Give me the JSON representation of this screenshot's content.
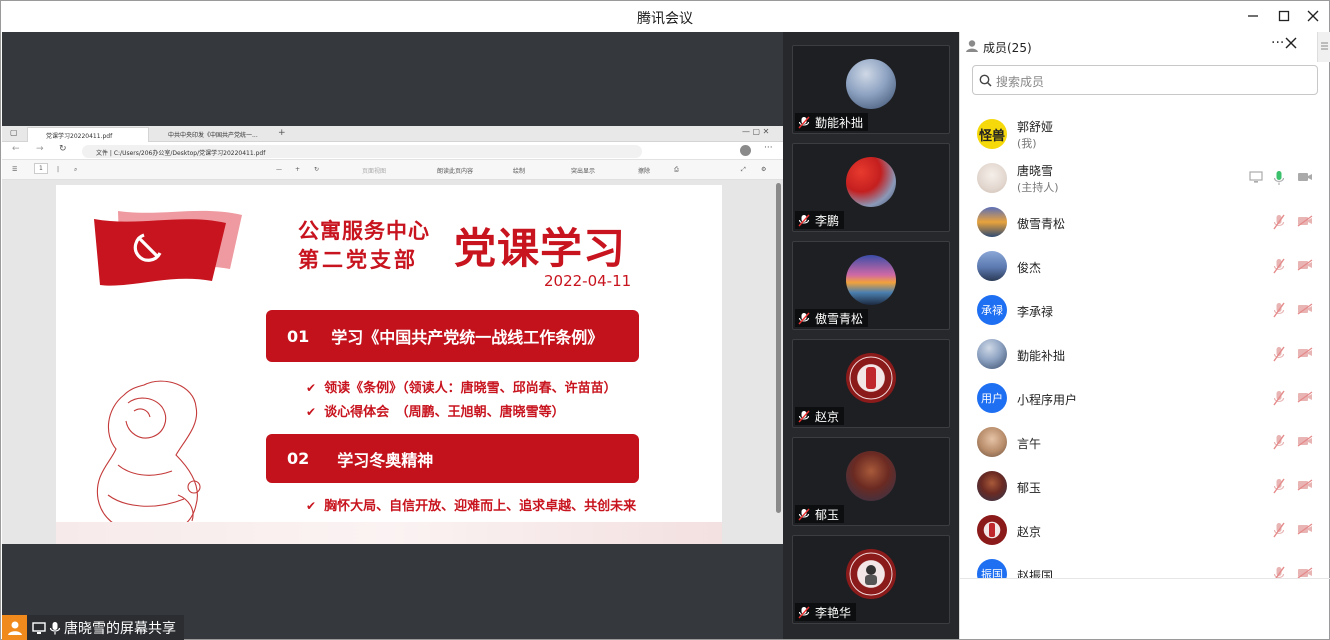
{
  "window": {
    "title": "腾讯会议"
  },
  "shared_screen": {
    "browser_tabs": [
      "党课学习20220411.pdf",
      "中共中央印发《中国共产党统一..."
    ],
    "url": "文件  |  C:/Users/206办公室/Desktop/党课学习20220411.pdf",
    "pdf_toolbar": {
      "page": "1",
      "items": [
        "页面视图",
        "朗读此页内容",
        "绘制",
        "突出显示",
        "擦除"
      ]
    },
    "slide": {
      "org_line1": "公寓服务中心",
      "org_line2": "第二党支部",
      "title": "党课学习",
      "date": "2022-04-11",
      "section1_num": "01",
      "section1_title": "学习《中国共产党统一战线工作条例》",
      "section1_items": [
        "领读《条例》（领读人：唐晓雪、邱尚春、许苗苗）",
        "谈心得体会　（周鹏、王旭朝、唐晓雪等）"
      ],
      "section2_num": "02",
      "section2_title": "学习冬奥精神",
      "section2_items": [
        "胸怀大局、自信开放、迎难而上、追求卓越、共创未来"
      ]
    },
    "share_label": "唐晓雪的屏幕共享"
  },
  "video_tiles": [
    {
      "name": "勤能补拙",
      "avatar": "sky-photo"
    },
    {
      "name": "李鹏",
      "avatar": "flag-photo"
    },
    {
      "name": "傲雪青松",
      "avatar": "sunset-photo"
    },
    {
      "name": "赵京",
      "avatar": "university-seal"
    },
    {
      "name": "郁玉",
      "avatar": "person-photo"
    },
    {
      "name": "李艳华",
      "avatar": "university-seal"
    }
  ],
  "members_panel": {
    "title": "成员(25)",
    "search_placeholder": "搜索成员",
    "members": [
      {
        "name": "郭舒娅",
        "sub": "(我)",
        "avatar_text": "怪兽",
        "avatar_color": "#f5d90a"
      },
      {
        "name": "唐晓雪",
        "sub": "(主持人)",
        "avatar_text": "",
        "avatar_color": "#e9e3df"
      },
      {
        "name": "傲雪青松",
        "sub": "",
        "avatar_text": "",
        "avatar_color": "#6f8fb5"
      },
      {
        "name": "俊杰",
        "sub": "",
        "avatar_text": "",
        "avatar_color": "#5e79a6"
      },
      {
        "name": "李承禄",
        "sub": "",
        "avatar_text": "承禄",
        "avatar_color": "#1f6ff2"
      },
      {
        "name": "勤能补拙",
        "sub": "",
        "avatar_text": "",
        "avatar_color": "#7d8fb0"
      },
      {
        "name": "小程序用户",
        "sub": "",
        "avatar_text": "用户",
        "avatar_color": "#1f6ff2"
      },
      {
        "name": "言午",
        "sub": "",
        "avatar_text": "",
        "avatar_color": "#b78c6a"
      },
      {
        "name": "郁玉",
        "sub": "",
        "avatar_text": "",
        "avatar_color": "#8a4a3a"
      },
      {
        "name": "赵京",
        "sub": "",
        "avatar_text": "",
        "avatar_color": "#8b1a1a"
      },
      {
        "name": "赵振国",
        "sub": "",
        "avatar_text": "振国",
        "avatar_color": "#1f6ff2"
      }
    ]
  },
  "colors": {
    "party_red": "#c8141e",
    "accent_blue": "#1f6ff2",
    "mic_on_green": "#3bc06b",
    "muted_red": "#e58a8a"
  }
}
